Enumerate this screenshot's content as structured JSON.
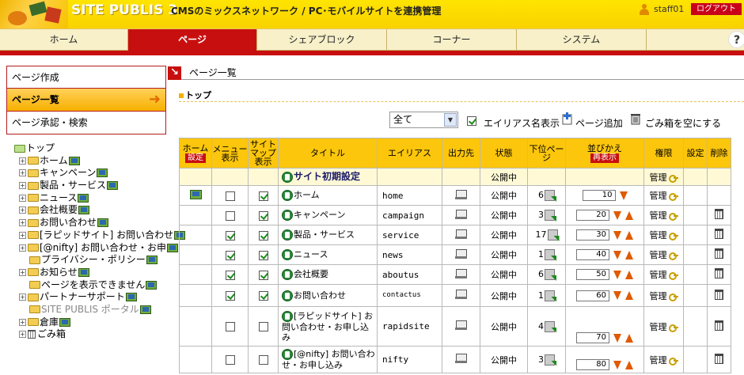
{
  "header": {
    "logo": "SITE PUBLIS 3",
    "tagline": "CMSのミックスネットワーク / PC･モバイルサイトを連携管理",
    "username": "staff01",
    "logout_label": "ログアウト"
  },
  "nav": {
    "tabs": [
      {
        "label": "ホーム",
        "active": false
      },
      {
        "label": "ページ",
        "active": true
      },
      {
        "label": "シェアブロック",
        "active": false
      },
      {
        "label": "コーナー",
        "active": false
      },
      {
        "label": "システム",
        "active": false
      }
    ],
    "help_label": "?"
  },
  "leftmenu": {
    "items": [
      {
        "label": "ページ作成",
        "active": false
      },
      {
        "label": "ページ一覧",
        "active": true,
        "arrow": "➜"
      },
      {
        "label": "ページ承認・検索",
        "active": false
      }
    ]
  },
  "tree": {
    "root": "トップ",
    "nodes": [
      {
        "label": "ホーム",
        "expander": "+"
      },
      {
        "label": "キャンペーン",
        "expander": "+"
      },
      {
        "label": "製品・サービス",
        "expander": "+"
      },
      {
        "label": "ニュース",
        "expander": "+"
      },
      {
        "label": "会社概要",
        "expander": "+"
      },
      {
        "label": "お問い合わせ",
        "expander": "+"
      },
      {
        "label": "[ラピッドサイト] お問い合わせ",
        "expander": "+"
      },
      {
        "label": "[@nifty] お問い合わせ・お申",
        "expander": "+"
      },
      {
        "label": "プライバシー・ポリシー",
        "expander": ""
      },
      {
        "label": "お知らせ",
        "expander": "+"
      },
      {
        "label": "ページを表示できません",
        "expander": ""
      },
      {
        "label": "パートナーサポート",
        "expander": "+"
      },
      {
        "label": "SITE PUBLIS ポータル",
        "expander": "",
        "dim": true
      },
      {
        "label": "倉庫",
        "expander": "+"
      },
      {
        "label": "ごみ箱",
        "expander": "+",
        "trash": true
      }
    ]
  },
  "main": {
    "breadcrumb_arrow": "↘",
    "title": "ページ一覧",
    "section": "トップ",
    "filter_value": "全て",
    "filter_dd": "▼",
    "alias_label": "エイリアス名表示",
    "alias_checked": true,
    "addpage_label": "ページ追加",
    "emptytrash_label": "ごみ箱を空にする"
  },
  "table": {
    "headers": {
      "home": "ホーム",
      "home_badge": "設定",
      "menu": "メニュー表示",
      "sitemap": "サイトマップ表示",
      "title": "タイトル",
      "alias": "エイリアス",
      "dest": "出力先",
      "status": "状態",
      "subpages": "下位ページ",
      "sort": "並びかえ",
      "sort_badge": "再表示",
      "perm": "権限",
      "settings": "設定",
      "delete": "削除"
    },
    "rows": [
      {
        "home_icon": false,
        "menu": null,
        "sitemap": null,
        "title": "サイト初期設定",
        "bold": true,
        "alias": "",
        "dest": false,
        "status": "公開中",
        "sub": "",
        "sort": "",
        "down": false,
        "up": false,
        "perm": "管理",
        "del": false,
        "hl": true
      },
      {
        "home_icon": true,
        "menu": false,
        "sitemap": true,
        "title": "ホーム",
        "alias": "home",
        "dest": true,
        "status": "公開中",
        "sub": "6",
        "sort": "10",
        "down": true,
        "up": false,
        "perm": "管理",
        "del": false
      },
      {
        "home_icon": false,
        "menu": false,
        "sitemap": true,
        "title": "キャンペーン",
        "alias": "campaign",
        "dest": true,
        "status": "公開中",
        "sub": "3",
        "sort": "20",
        "down": true,
        "up": true,
        "perm": "管理",
        "del": true
      },
      {
        "home_icon": false,
        "menu": true,
        "sitemap": true,
        "title": "製品・サービス",
        "alias": "service",
        "dest": true,
        "status": "公開中",
        "sub": "17",
        "sort": "30",
        "down": true,
        "up": true,
        "perm": "管理",
        "del": true
      },
      {
        "home_icon": false,
        "menu": true,
        "sitemap": true,
        "title": "ニュース",
        "alias": "news",
        "dest": true,
        "status": "公開中",
        "sub": "1",
        "sort": "40",
        "down": true,
        "up": true,
        "perm": "管理",
        "del": true
      },
      {
        "home_icon": false,
        "menu": true,
        "sitemap": true,
        "title": "会社概要",
        "alias": "aboutus",
        "dest": true,
        "status": "公開中",
        "sub": "6",
        "sort": "50",
        "down": true,
        "up": true,
        "perm": "管理",
        "del": true
      },
      {
        "home_icon": false,
        "menu": true,
        "sitemap": true,
        "title": "お問い合わせ",
        "alias": "contactus",
        "dest": true,
        "status": "公開中",
        "sub": "1",
        "sort": "60",
        "down": true,
        "up": true,
        "perm": "管理",
        "del": true
      },
      {
        "home_icon": false,
        "menu": false,
        "sitemap": false,
        "title": "[ラピッドサイト] お問い合わせ・お申し込み",
        "alias": "rapidsite",
        "dest": true,
        "status": "公開中",
        "sub": "4",
        "sort": "70",
        "down": true,
        "up": true,
        "perm": "管理",
        "del": true
      },
      {
        "home_icon": false,
        "menu": false,
        "sitemap": false,
        "title": "[@nifty] お問い合わせ・お申し込み",
        "alias": "nifty",
        "dest": true,
        "status": "公開中",
        "sub": "3",
        "sort": "80",
        "down": true,
        "up": true,
        "perm": "管理",
        "del": true
      }
    ]
  },
  "colors": {
    "accent_red": "#c80f0f",
    "header_yellow": "#ffe400",
    "table_header": "#fcc60c"
  }
}
